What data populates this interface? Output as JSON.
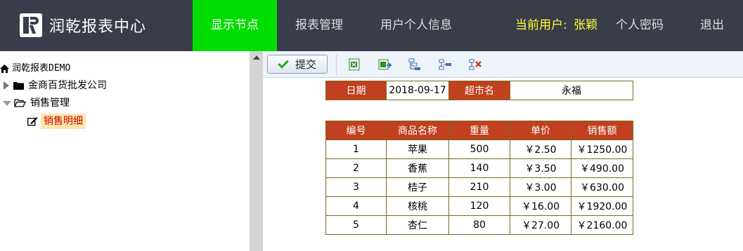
{
  "app": {
    "title": "润乾报表中心"
  },
  "nav": {
    "items": [
      "显示节点",
      "报表管理",
      "用户个人信息"
    ],
    "active_index": 0
  },
  "user": {
    "label": "当前用户:",
    "name": "张颖"
  },
  "nav_right": {
    "password": "个人密码",
    "logout": "退出"
  },
  "tree": {
    "root": "润乾报表DEMO",
    "nodes": [
      {
        "label": "金商百货批发公司",
        "expanded": false
      },
      {
        "label": "销售管理",
        "expanded": true,
        "children": [
          {
            "label": "销售明细",
            "selected": true
          }
        ]
      }
    ]
  },
  "toolbar": {
    "submit_label": "提交",
    "icons": [
      "excel-export-icon",
      "excel-import-icon",
      "insert-row-icon",
      "append-row-icon",
      "delete-row-icon"
    ]
  },
  "report": {
    "header": {
      "date_label": "日期",
      "date_value": "2018-09-17",
      "market_label": "超市名",
      "market_value": "永福"
    },
    "columns": [
      "编号",
      "商品名称",
      "重量",
      "单价",
      "销售额"
    ],
    "rows": [
      [
        "1",
        "苹果",
        "500",
        "￥2.50",
        "￥1250.00"
      ],
      [
        "2",
        "香蕉",
        "140",
        "￥3.50",
        "￥490.00"
      ],
      [
        "3",
        "桔子",
        "210",
        "￥3.00",
        "￥630.00"
      ],
      [
        "4",
        "核桃",
        "120",
        "￥16.00",
        "￥1920.00"
      ],
      [
        "5",
        "杏仁",
        "80",
        "￥27.00",
        "￥2160.00"
      ]
    ]
  },
  "colors": {
    "topbar": "#393d49",
    "nav_active": "#00dd00",
    "table_header": "#c04020",
    "user_highlight": "#ffff33"
  }
}
